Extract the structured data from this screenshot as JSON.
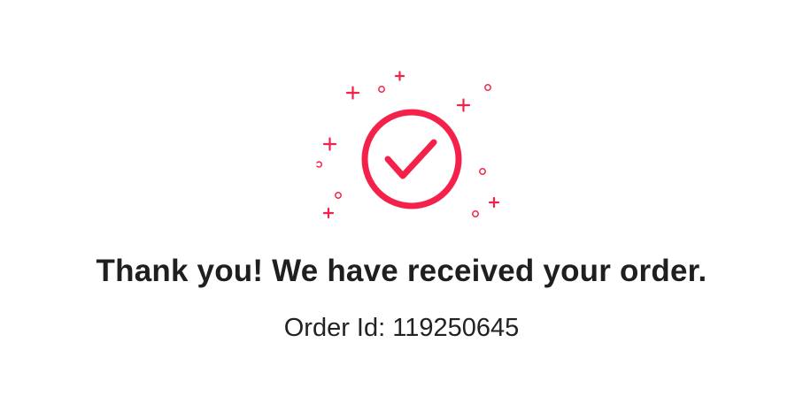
{
  "confirmation": {
    "icon": "check-circle-icon",
    "accent_color": "#f4224a",
    "headline": "Thank you! We have received your order.",
    "order_label": "Order Id:",
    "order_id": "119250645"
  }
}
